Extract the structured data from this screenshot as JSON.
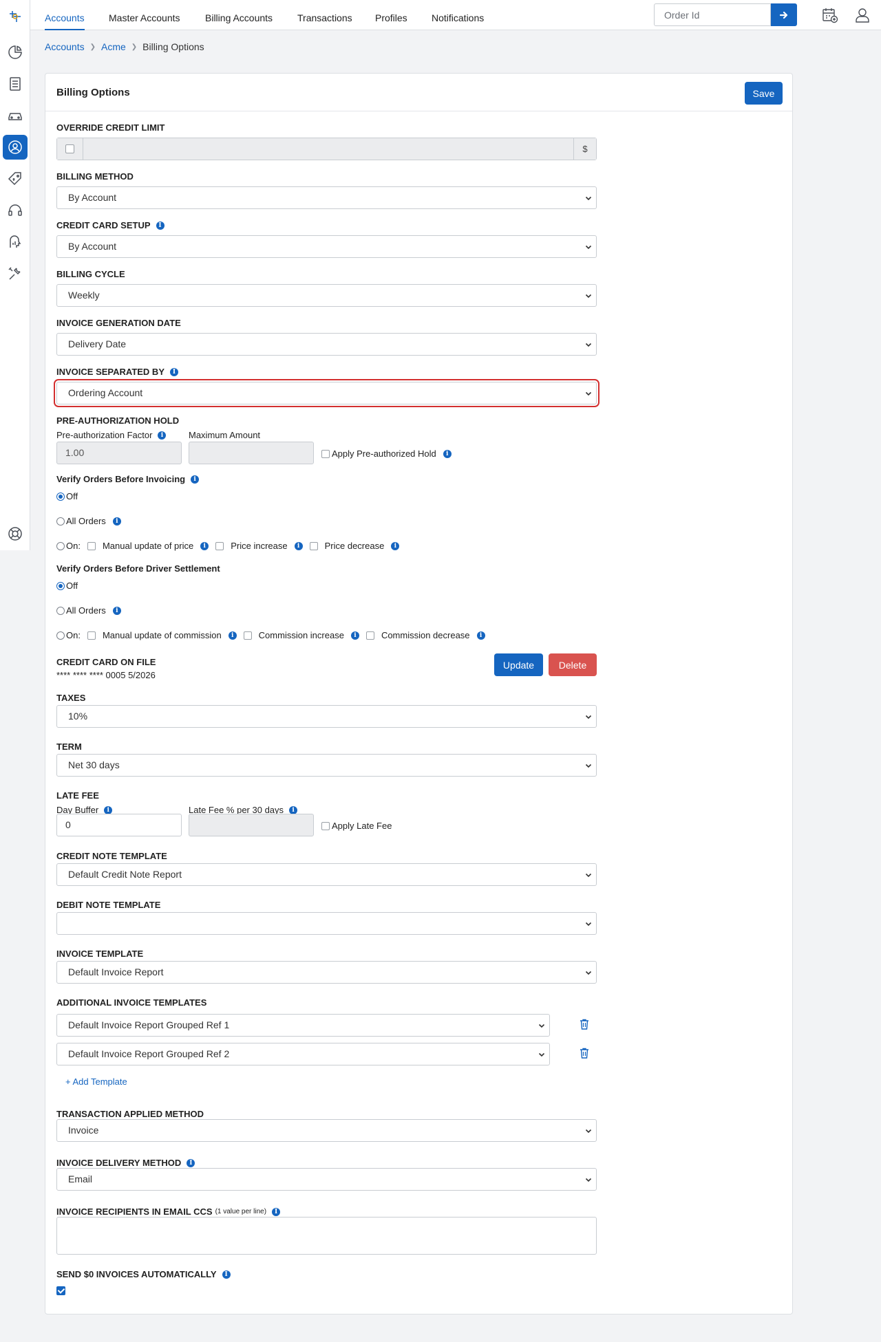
{
  "topnav": {
    "tabs": [
      "Accounts",
      "Master Accounts",
      "Billing Accounts",
      "Transactions",
      "Profiles",
      "Notifications"
    ],
    "order_placeholder": "Order Id"
  },
  "sidebar_icons": [
    "logo-icon",
    "dashboard-pie-icon",
    "orders-list-icon",
    "vehicle-icon",
    "accounts-user-icon",
    "pricing-tag-icon",
    "support-headset-icon",
    "reports-icon",
    "tools-icon",
    "help-lifebuoy-icon"
  ],
  "breadcrumb": {
    "item1": "Accounts",
    "item2": "Acme",
    "current": "Billing Options"
  },
  "card": {
    "title": "Billing Options",
    "save": "Save"
  },
  "override": {
    "label": "OVERRIDE CREDIT LIMIT",
    "currency": "$"
  },
  "billing_method": {
    "label": "BILLING METHOD",
    "value": "By Account"
  },
  "credit_card_setup": {
    "label": "CREDIT CARD SETUP",
    "value": "By Account"
  },
  "billing_cycle": {
    "label": "BILLING CYCLE",
    "value": "Weekly"
  },
  "invoice_generation_date": {
    "label": "INVOICE GENERATION DATE",
    "value": "Delivery Date"
  },
  "invoice_separated_by": {
    "label": "INVOICE SEPARATED BY",
    "value": "Ordering Account"
  },
  "preauth": {
    "label": "PRE-AUTHORIZATION HOLD",
    "factor_label": "Pre-authorization Factor",
    "factor_value": "1.00",
    "max_label": "Maximum Amount",
    "apply_label": "Apply Pre-authorized Hold"
  },
  "verify_invoicing": {
    "label": "Verify Orders Before Invoicing",
    "off": "Off",
    "all": "All Orders",
    "on": "On:",
    "opt1": "Manual update of price",
    "opt2": "Price increase",
    "opt3": "Price decrease"
  },
  "verify_settlement": {
    "label": "Verify Orders Before Driver Settlement",
    "off": "Off",
    "all": "All Orders",
    "on": "On:",
    "opt1": "Manual update of commission",
    "opt2": "Commission increase",
    "opt3": "Commission decrease"
  },
  "credit_card": {
    "label": "CREDIT CARD ON FILE",
    "number": "**** **** **** 0005 5/2026",
    "update": "Update",
    "delete": "Delete"
  },
  "taxes": {
    "label": "TAXES",
    "value": "10%"
  },
  "term": {
    "label": "TERM",
    "value": "Net 30 days"
  },
  "late_fee": {
    "label": "LATE FEE",
    "buffer_label": "Day Buffer",
    "buffer_value": "0",
    "pct_label": "Late Fee % per 30 days",
    "apply_label": "Apply Late Fee"
  },
  "credit_note": {
    "label": "CREDIT NOTE TEMPLATE",
    "value": "Default Credit Note Report"
  },
  "debit_note": {
    "label": "DEBIT NOTE TEMPLATE",
    "value": ""
  },
  "invoice_template": {
    "label": "INVOICE TEMPLATE",
    "value": "Default Invoice Report"
  },
  "additional": {
    "label": "ADDITIONAL INVOICE TEMPLATES",
    "t1": "Default Invoice Report Grouped Ref 1",
    "t2": "Default Invoice Report Grouped Ref 2",
    "add": "+ Add Template"
  },
  "transaction_method": {
    "label": "TRANSACTION APPLIED METHOD",
    "value": "Invoice"
  },
  "delivery_method": {
    "label": "INVOICE DELIVERY METHOD",
    "value": "Email"
  },
  "recipients": {
    "label": "INVOICE RECIPIENTS IN EMAIL CCS",
    "hint": "(1 value per line)"
  },
  "send_zero": {
    "label": "SEND $0 INVOICES AUTOMATICALLY"
  },
  "colors": {
    "primary": "#1565c0",
    "danger": "#d9534f",
    "highlight": "#d32f2f"
  }
}
